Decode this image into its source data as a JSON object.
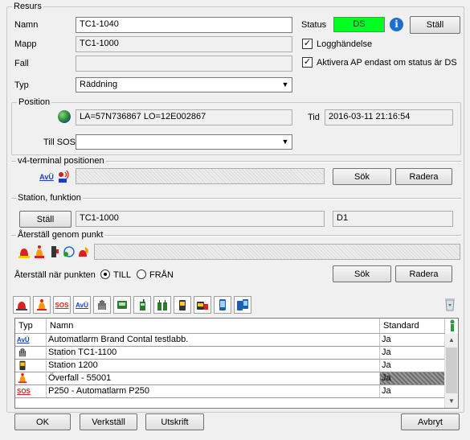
{
  "resurs": {
    "group_title": "Resurs",
    "name_label": "Namn",
    "name_value": "TC1-1040",
    "mapp_label": "Mapp",
    "mapp_value": "TC1-1000",
    "fall_label": "Fall",
    "fall_value": "",
    "typ_label": "Typ",
    "typ_value": "Räddning",
    "status_label": "Status",
    "status_value": "DS",
    "status_color": "#00ff21",
    "stall_button": "Ställ",
    "logg_label": "Logghändelse",
    "aktivera_label": "Aktivera AP endast om status är DS"
  },
  "position": {
    "group_title": "Position",
    "coords": "LA=57N736867 LO=12E002867",
    "tid_label": "Tid",
    "tid_value": "2016-03-11 21:16:54",
    "till_sos_label": "Till SOS",
    "till_sos_value": ""
  },
  "v4": {
    "group_title": "v4-terminal positionen",
    "icon1_text": "AvÜ",
    "sok_button": "Sök",
    "radera_button": "Radera"
  },
  "station": {
    "group_title": "Station, funktion",
    "stall_button": "Ställ",
    "station_value": "TC1-1000",
    "funktion_value": "D1"
  },
  "aterstall": {
    "group_title": "Återställ genom punkt",
    "when_label": "Återställ när punkten",
    "till_label": "TILL",
    "fran_label": "FRÅN",
    "sok_button": "Sök",
    "radera_button": "Radera"
  },
  "toolbar": {
    "icons": [
      "alarm-siren-icon",
      "person-siren-icon",
      "sos-icon",
      "avu-icon",
      "hand-icon",
      "pager-icon",
      "radio-icon",
      "radio-pair-icon",
      "yellow-radio-icon",
      "vehicle-terminal-icon",
      "mobile-phone-icon",
      "phone-pair-icon"
    ],
    "sos_text": "SOS",
    "avu_text": "AvÜ"
  },
  "grid": {
    "col_typ": "Typ",
    "col_namn": "Namn",
    "col_standard": "Standard",
    "rows": [
      {
        "icon": "avu-icon",
        "icon_text": "AvÜ",
        "namn": "Automatlarm Brand Contal testlabb.",
        "standard": "Ja"
      },
      {
        "icon": "hand-icon",
        "icon_text": "",
        "namn": "Station TC1-1100",
        "standard": "Ja"
      },
      {
        "icon": "yellow-radio-icon",
        "icon_text": "",
        "namn": "Station 1200",
        "standard": "Ja"
      },
      {
        "icon": "person-siren-icon",
        "icon_text": "",
        "namn": "Överfall - 55001",
        "standard": "Ja"
      },
      {
        "icon": "sos-icon",
        "icon_text": "SOS",
        "namn": "P250 - Automatlarm P250",
        "standard": "Ja"
      }
    ]
  },
  "footer": {
    "ok_button": "OK",
    "verkstall_button": "Verkställ",
    "utskrift_button": "Utskrift",
    "avbryt_button": "Avbryt"
  }
}
